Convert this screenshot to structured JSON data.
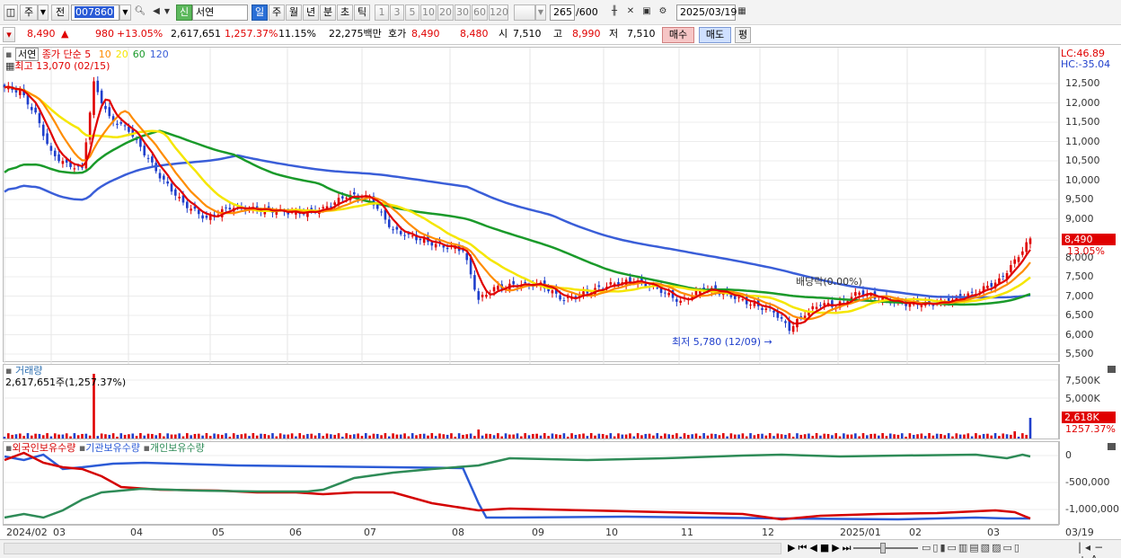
{
  "toolbar": {
    "market_label": "주",
    "prev_label": "전",
    "code": "007860",
    "stock_flag": "신",
    "stock_name": "서연",
    "periods": [
      "일",
      "주",
      "월",
      "년",
      "분",
      "초",
      "틱"
    ],
    "minutes": [
      "1",
      "3",
      "5",
      "10",
      "20",
      "30",
      "60",
      "120"
    ],
    "count": "265",
    "count_total": "/600",
    "date": "2025/03/19"
  },
  "quote": {
    "price": "8,490",
    "arrow": "▲",
    "change": "980",
    "change_pct": "+13.05%",
    "volume": "2,617,651",
    "volume_pct": "1,257.37%",
    "turnover": "11.15%",
    "amount": "22,275백만",
    "hoga_label": "호가",
    "ask": "8,490",
    "bid": "8,480",
    "open_label": "시",
    "open": "7,510",
    "high_label": "고",
    "high": "8,990",
    "low_label": "저",
    "low": "7,510",
    "buy_label": "매수",
    "sell_label": "매도",
    "eval_label": "평"
  },
  "price_pane": {
    "stock_label": "서연",
    "ma_label": "종가 단순 5",
    "ma_periods": [
      "10",
      "20",
      "60",
      "120"
    ],
    "high_note": "최고 13,070 (02/15)",
    "low_note": "최저 5,780 (12/09)",
    "dividend_note": "배당락(0.00%)",
    "lc": "LC:46.89",
    "hc": "HC:-35.04",
    "price_tag": "8,490",
    "pct_tag": "13.05%",
    "y_labels": [
      "12,500",
      "12,000",
      "11,500",
      "11,000",
      "10,500",
      "10,000",
      "9,500",
      "9,000",
      "8,500",
      "8,000",
      "7,500",
      "7,000",
      "6,500",
      "6,000",
      "5,500"
    ]
  },
  "volume_pane": {
    "title": "거래량",
    "value": "2,617,651주(1,257.37%)",
    "y_labels": [
      "7,500K",
      "5,000K"
    ],
    "vol_tag": "2,618K",
    "pct_tag": "1257.37%"
  },
  "holding_pane": {
    "legend": [
      "외국인보유수량",
      "기관보유수량",
      "개인보유수량"
    ],
    "y_labels": [
      "0",
      "-500,000",
      "-1,000,000"
    ]
  },
  "x_axis": {
    "labels": [
      "2024/02",
      "03",
      "04",
      "05",
      "06",
      "07",
      "08",
      "09",
      "10",
      "11",
      "12",
      "2025/01",
      "02",
      "03"
    ],
    "end_label": "03/19"
  },
  "colors": {
    "up": "#e00000",
    "down": "#1f3fcc",
    "ma5": "#e00000",
    "ma10": "#ff8c00",
    "ma20": "#f5e600",
    "ma60": "#1a9a2a",
    "ma120": "#3a5ed8",
    "foreign": "#d40000",
    "institution": "#2c5bd6",
    "individual": "#2e8b57"
  }
}
